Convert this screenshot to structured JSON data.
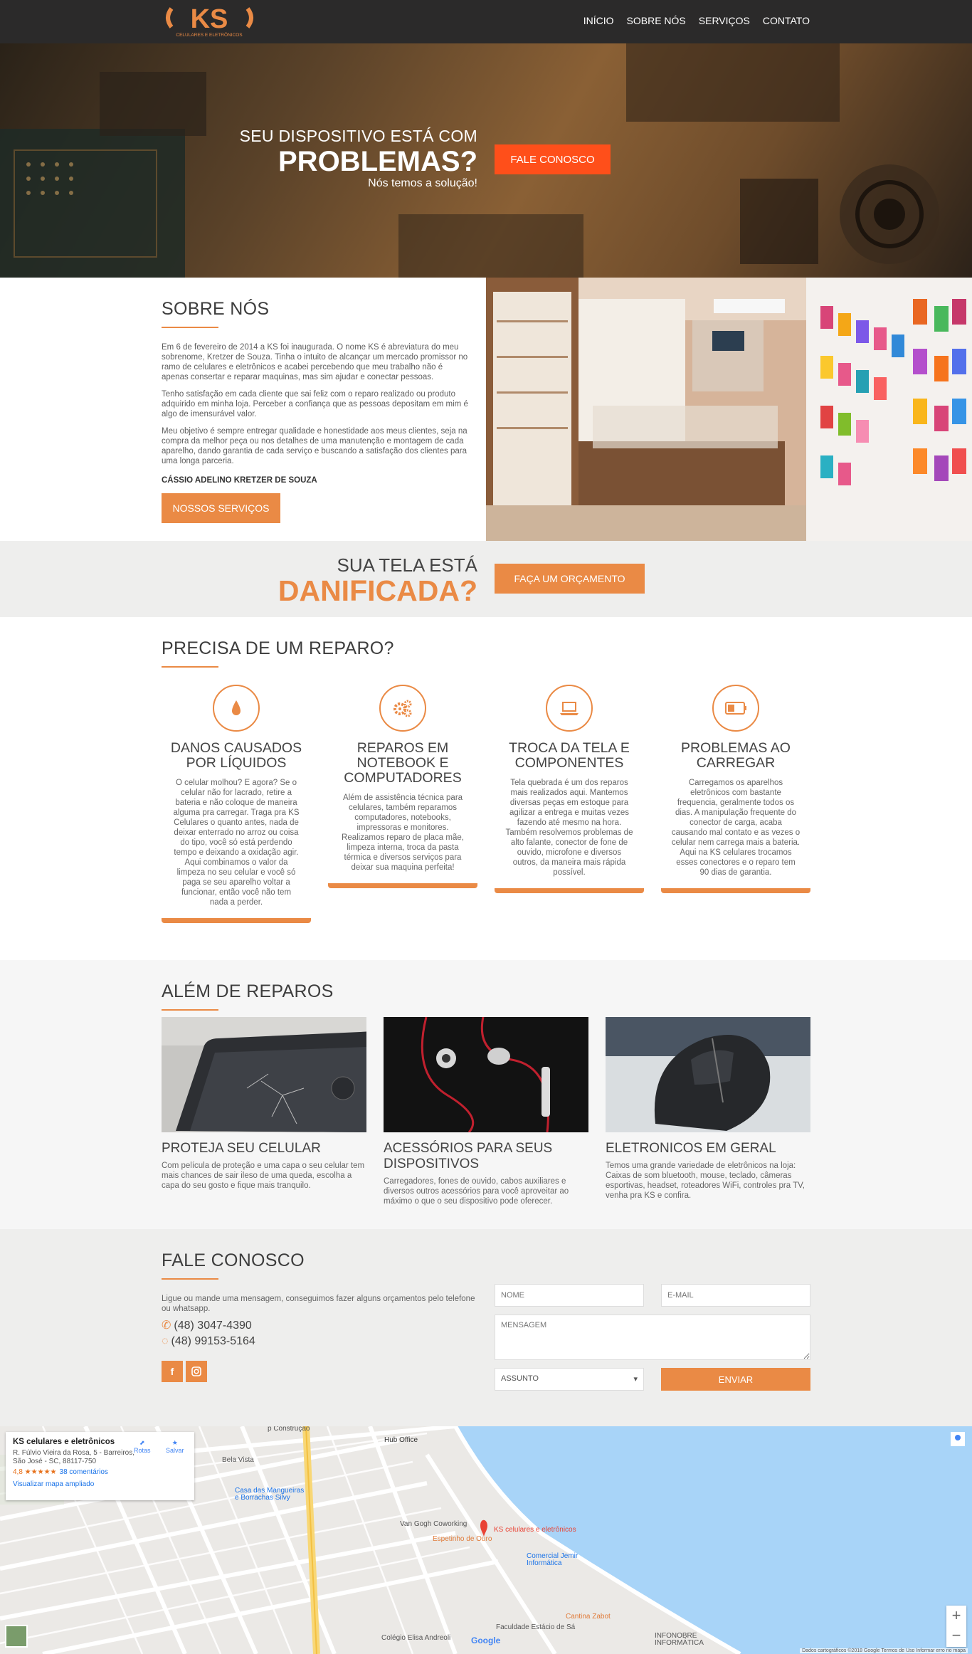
{
  "brand": {
    "logo_text": "KS",
    "logo_sub": "CELULARES E ELETRÔNICOS",
    "accent": "#ea8a45",
    "cta_red": "#ff4f1a"
  },
  "nav": {
    "items": [
      "INÍCIO",
      "SOBRE NÓS",
      "SERVIÇOS",
      "CONTATO"
    ]
  },
  "hero": {
    "line1": "SEU DISPOSITIVO ESTÁ COM",
    "line2": "PROBLEMAS?",
    "line3": "Nós temos a solução!",
    "button": "FALE CONOSCO"
  },
  "about": {
    "title": "SOBRE NÓS",
    "paragraphs": [
      "Em 6 de fevereiro de 2014 a KS foi inaugurada. O nome KS é abreviatura do meu sobrenome, Kretzer de Souza. Tinha o intuito de alcançar um mercado promissor no ramo de celulares e eletrônicos e acabei percebendo que meu trabalho não é apenas consertar e reparar maquinas, mas sim ajudar e conectar pessoas.",
      "Tenho satisfação em cada cliente que sai feliz com o reparo realizado ou produto adquirido em minha loja. Perceber a confiança que as pessoas depositam em mim é algo de imensurável valor.",
      "Meu objetivo é sempre entregar qualidade e honestidade aos meus clientes, seja na compra da melhor peça ou nos detalhes de uma manutenção e montagem de cada aparelho, dando garantia de cada serviço e buscando a satisfação dos clientes para uma longa parceria."
    ],
    "signature": "CÁSSIO ADELINO KRETZER DE SOUZA",
    "button": "NOSSOS SERVIÇOS"
  },
  "damaged": {
    "line1": "SUA TELA ESTÁ",
    "line2": "DANIFICADA?",
    "button": "FAÇA UM ORÇAMENTO"
  },
  "repair": {
    "title": "PRECISA DE UM REPARO?",
    "cards": [
      {
        "icon": "water-drop-icon",
        "title": "DANOS CAUSADOS POR LÍQUIDOS",
        "text": "O celular molhou? E agora? Se o celular não for lacrado, retire a bateria e não coloque de maneira alguma pra carregar. Traga pra KS Celulares o quanto antes, nada de deixar enterrado no arroz ou coisa do tipo, você só está perdendo tempo e deixando a oxidação agir. Aqui combinamos o valor da limpeza no seu celular e você só paga se seu aparelho voltar a funcionar, então você não tem nada a perder."
      },
      {
        "icon": "gears-icon",
        "title": "REPAROS EM NOTEBOOK E COMPUTADORES",
        "text": "Além de assistência técnica para celulares, também reparamos computadores, notebooks, impressoras e monitores. Realizamos reparo de placa mãe, limpeza interna, troca da pasta térmica e diversos serviços para deixar sua maquina perfeita!"
      },
      {
        "icon": "laptop-icon",
        "title": "TROCA DA TELA E COMPONENTES",
        "text": "Tela quebrada é um dos reparos mais realizados aqui. Mantemos diversas peças em estoque para agilizar a entrega e muitas vezes fazendo até mesmo na hora. Também resolvemos problemas de alto falante, conector de fone de ouvido, microfone e diversos outros, da maneira mais rápida possível."
      },
      {
        "icon": "battery-icon",
        "title": "PROBLEMAS AO CARREGAR",
        "text": "Carregamos os aparelhos eletrônicos com bastante frequencia, geralmente todos os dias. A manipulação frequente do conector de carga, acaba causando mal contato e as vezes o celular nem carrega mais a bateria. Aqui na KS celulares trocamos esses conectores e o reparo tem 90 dias de garantia."
      }
    ]
  },
  "beyond": {
    "title": "ALÉM DE REPAROS",
    "items": [
      {
        "title": "PROTEJA SEU CELULAR",
        "text": "Com película de proteção e uma capa o seu celular tem mais chances de sair ileso de uma queda, escolha a capa do seu gosto e fique mais tranquilo."
      },
      {
        "title": "ACESSÓRIOS PARA SEUS DISPOSITIVOS",
        "text": "Carregadores, fones de ouvido, cabos auxiliares e diversos outros acessórios para você aproveitar ao máximo o que o seu dispositivo pode oferecer."
      },
      {
        "title": "ELETRONICOS EM GERAL",
        "text": "Temos uma grande variedade de eletrônicos na loja: Caixas de som bluetooth, mouse, teclado, câmeras esportivas, headset, roteadores WiFi, controles pra TV, venha pra KS e confira."
      }
    ]
  },
  "contact": {
    "title": "FALE CONOSCO",
    "desc": "Ligue ou mande uma mensagem, conseguimos fazer alguns orçamentos pelo telefone ou whatsapp.",
    "phone": "(48) 3047-4390",
    "whatsapp": "(48) 99153-5164",
    "social": [
      "f",
      "ig"
    ],
    "form": {
      "name_ph": "NOME",
      "email_ph": "E-MAIL",
      "msg_ph": "MENSAGEM",
      "subject": "ASSUNTO",
      "submit": "ENVIAR"
    }
  },
  "map": {
    "place": "KS celulares e eletrônicos",
    "address": "R. Fúlvio Vieira da Rosa, 5 - Barreiros, São José - SC, 88117-750",
    "rating": "4,8 ★★★★★",
    "reviews": "38 comentários",
    "expand": "Visualizar mapa ampliado",
    "routes": "Rotas",
    "save": "Salvar",
    "labels": [
      "Hub Office",
      "Van Gogh Coworking",
      "Espetinho de Ouro",
      "Comercial Jemir Informática",
      "Cantina Zabot",
      "Faculdade Estácio de Sá",
      "Colégio Elisa Andreoli",
      "INFONOBRE INFORMÁTICA",
      "Casa das Mangueiras e Borrachas Silvy",
      "Bela Vista",
      "p Construção"
    ],
    "attribution": "Dados cartográficos ©2018 Google   Termos de Uso   Informar erro no mapa",
    "google": "Google",
    "water": "#a8d4f8"
  }
}
